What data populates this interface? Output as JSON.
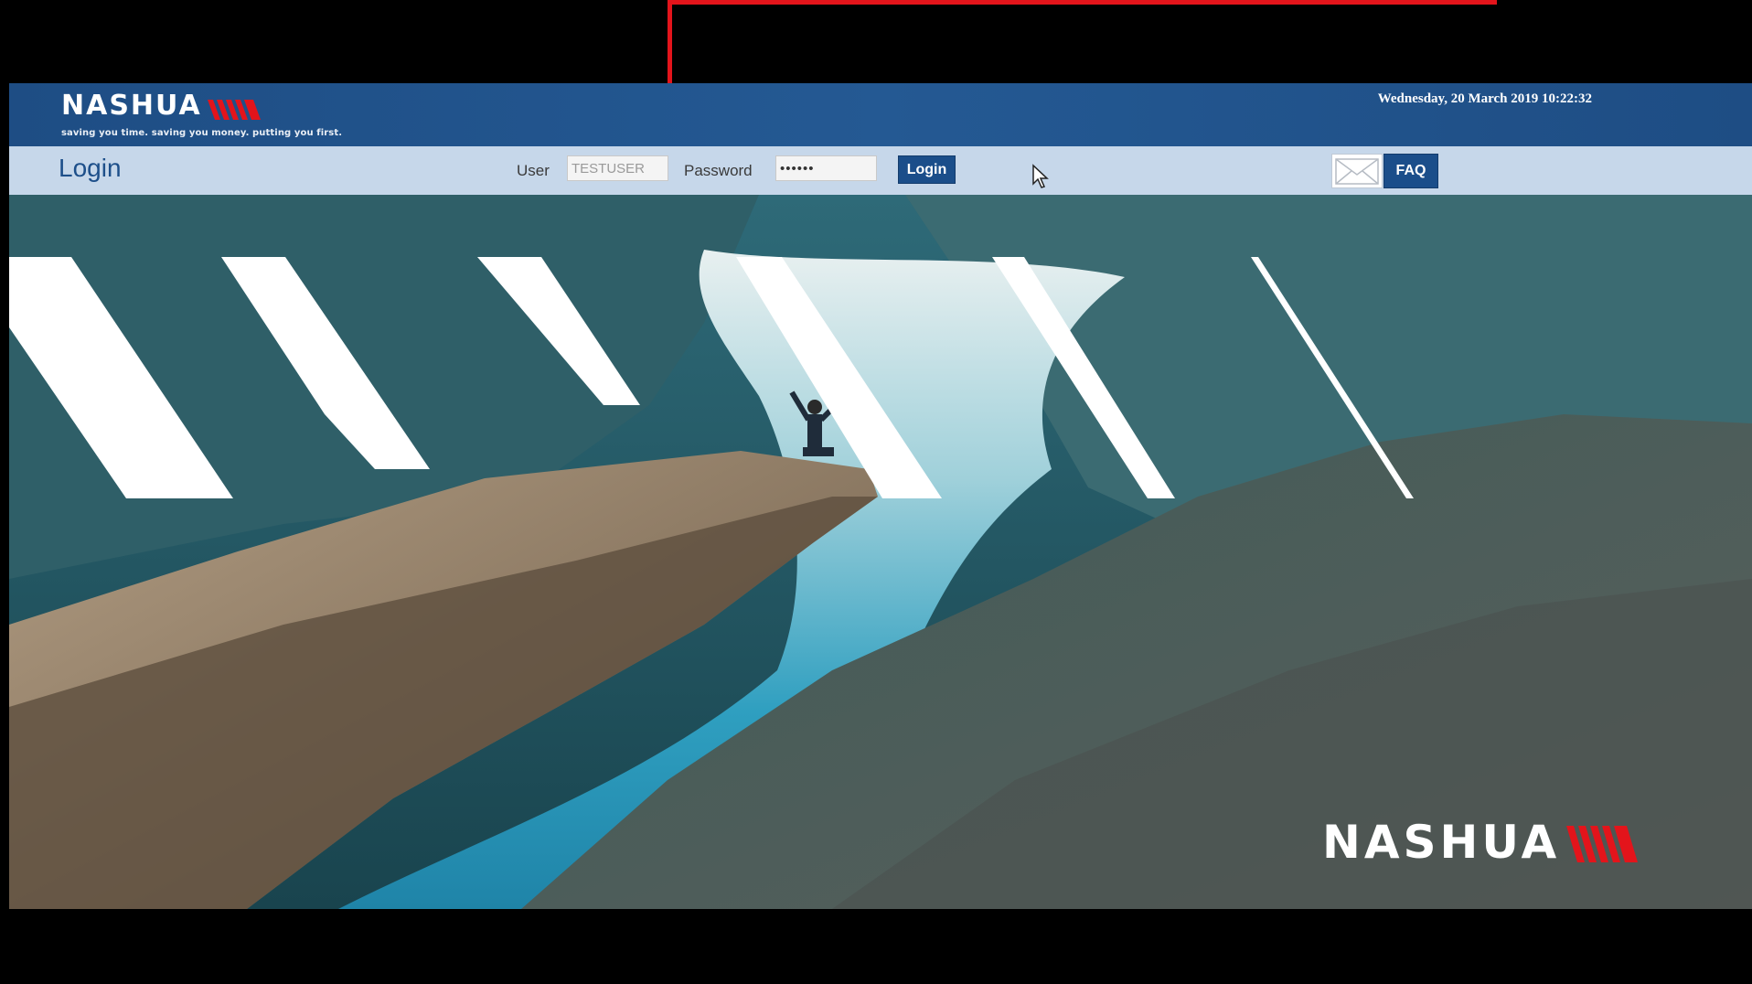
{
  "header": {
    "brand_name": "NASHUA",
    "tagline": "saving you time. saving you money. putting you first.",
    "datetime": "Wednesday, 20 March 2019 10:22:32"
  },
  "login_bar": {
    "title": "Login",
    "user_label": "User",
    "user_value": "TESTUSER",
    "password_label": "Password",
    "password_value": "••••••",
    "login_button": "Login",
    "faq_button": "FAQ"
  },
  "hero": {
    "brand_name": "NASHUA"
  },
  "colors": {
    "header_blue": "#1e4f86",
    "login_bar": "#c6d7ea",
    "button_blue": "#1b4e8a",
    "brand_red": "#e3141b",
    "callout_red": "#e3141b"
  },
  "icons": [
    "mail-icon",
    "cursor-icon",
    "brand-stripes-icon"
  ]
}
